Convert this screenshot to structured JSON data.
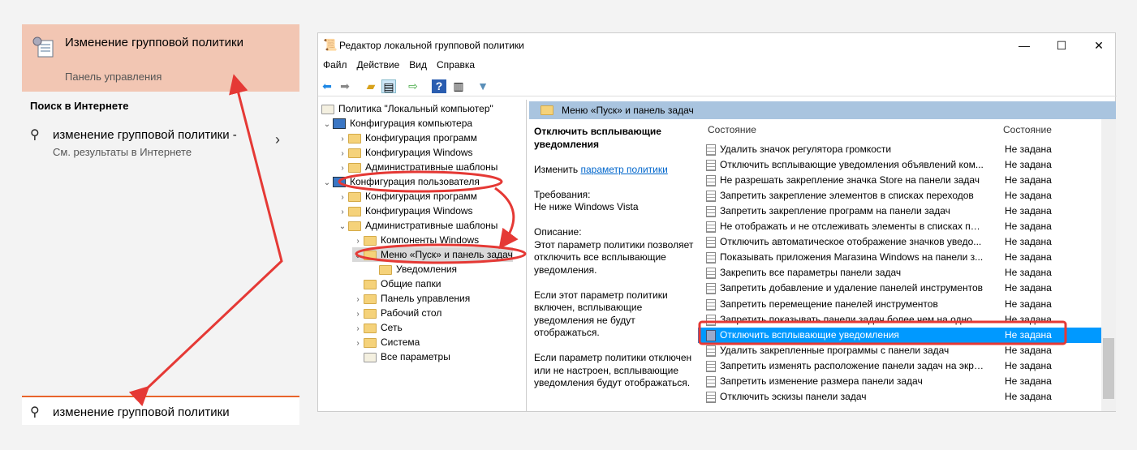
{
  "start": {
    "best": {
      "title": "Изменение групповой политики",
      "subtitle": "Панель управления"
    },
    "web_header": "Поиск в Интернете",
    "web_result": {
      "title": "изменение групповой политики -",
      "subtitle": "См. результаты в Интернете"
    },
    "search_value": "изменение групповой политики"
  },
  "window": {
    "title": "Редактор локальной групповой политики",
    "menu": [
      "Файл",
      "Действие",
      "Вид",
      "Справка"
    ],
    "tree": [
      {
        "label": "Политика \"Локальный компьютер\"",
        "lvl": 0,
        "ex": "",
        "icon": "doc"
      },
      {
        "label": "Конфигурация компьютера",
        "lvl": 0,
        "ex": "⌄",
        "icon": "cfg"
      },
      {
        "label": "Конфигурация программ",
        "lvl": 1,
        "ex": "›",
        "icon": "fold"
      },
      {
        "label": "Конфигурация Windows",
        "lvl": 1,
        "ex": "›",
        "icon": "fold"
      },
      {
        "label": "Административные шаблоны",
        "lvl": 1,
        "ex": "›",
        "icon": "fold"
      },
      {
        "label": "Конфигурация пользователя",
        "lvl": 0,
        "ex": "⌄",
        "icon": "cfg"
      },
      {
        "label": "Конфигурация программ",
        "lvl": 1,
        "ex": "›",
        "icon": "fold"
      },
      {
        "label": "Конфигурация Windows",
        "lvl": 1,
        "ex": "›",
        "icon": "fold"
      },
      {
        "label": "Административные шаблоны",
        "lvl": 1,
        "ex": "⌄",
        "icon": "fold"
      },
      {
        "label": "Компоненты Windows",
        "lvl": 2,
        "ex": "›",
        "icon": "fold"
      },
      {
        "label": "Меню «Пуск» и панель задач",
        "lvl": 2,
        "ex": "⌄",
        "icon": "fold",
        "selected": true
      },
      {
        "label": "Уведомления",
        "lvl": 3,
        "ex": "",
        "icon": "fold"
      },
      {
        "label": "Общие папки",
        "lvl": 2,
        "ex": "",
        "icon": "fold"
      },
      {
        "label": "Панель управления",
        "lvl": 2,
        "ex": "›",
        "icon": "fold"
      },
      {
        "label": "Рабочий стол",
        "lvl": 2,
        "ex": "›",
        "icon": "fold"
      },
      {
        "label": "Сеть",
        "lvl": 2,
        "ex": "›",
        "icon": "fold"
      },
      {
        "label": "Система",
        "lvl": 2,
        "ex": "›",
        "icon": "fold"
      },
      {
        "label": "Все параметры",
        "lvl": 2,
        "ex": "",
        "icon": "all"
      }
    ],
    "header": "Меню «Пуск» и панель задач",
    "desc": {
      "title": "Отключить всплывающие уведомления",
      "edit_prefix": "Изменить",
      "edit_link": "параметр политики",
      "req_label": "Требования:",
      "req": "Не ниже Windows Vista",
      "desc_label": "Описание:",
      "p1": "Этот параметр политики позволяет отключить все всплывающие уведомления.",
      "p2": "Если этот параметр политики включен, всплывающие уведомления не будут отображаться.",
      "p3": "Если параметр политики отключен или не настроен, всплывающие уведомления будут отображаться."
    },
    "columns": [
      "Состояние",
      "Состояние"
    ],
    "rows": [
      [
        "Удалить значок регулятора громкости",
        "Не задана"
      ],
      [
        "Отключить всплывающие уведомления объявлений ком...",
        "Не задана"
      ],
      [
        "Не разрешать закрепление значка Store на панели задач",
        "Не задана"
      ],
      [
        "Запретить закрепление элементов в списках переходов",
        "Не задана"
      ],
      [
        "Запретить закрепление программ на панели задач",
        "Не задана"
      ],
      [
        "Не отображать и не отслеживать элементы в списках пе...",
        "Не задана"
      ],
      [
        "Отключить автоматическое отображение значков уведо...",
        "Не задана"
      ],
      [
        "Показывать приложения Магазина Windows на панели з...",
        "Не задана"
      ],
      [
        "Закрепить все параметры панели задач",
        "Не задана"
      ],
      [
        "Запретить добавление и удаление панелей инструментов",
        "Не задана"
      ],
      [
        "Запретить перемещение панелей инструментов",
        "Не задана"
      ],
      [
        "Запретить показывать панели задач более чем на одном ...",
        "Не задана"
      ],
      [
        "Отключить всплывающие уведомления",
        "Не задана"
      ],
      [
        "Удалить закрепленные программы с панели задач",
        "Не задана"
      ],
      [
        "Запретить изменять расположение панели задач на экра...",
        "Не задана"
      ],
      [
        "Запретить изменение размера панели задач",
        "Не задана"
      ],
      [
        "Отключить эскизы панели задач",
        "Не задана"
      ]
    ],
    "selected_row": 12
  },
  "colors": {
    "highlight": "#f2c6b3",
    "accent": "#e8642c",
    "selection": "#0099ff",
    "annotation": "#e53935"
  }
}
